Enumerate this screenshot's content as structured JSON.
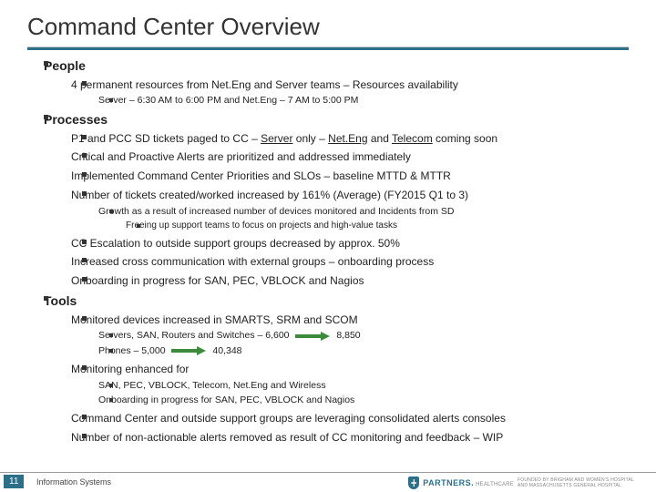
{
  "title": "Command Center Overview",
  "page_number": "11",
  "footer_label": "Information Systems",
  "logo": {
    "brand": "PARTNERS.",
    "sub": "HEALTHCARE",
    "tag": "FOUNDED BY BRIGHAM AND WOMEN'S HOSPITAL AND MASSACHUSETTS GENERAL HOSPITAL"
  },
  "sections": {
    "people": {
      "label": "People",
      "items": {
        "i0": "4 permanent resources from Net.Eng and Server teams – Resources availability",
        "i0_sub": "Server – 6:30 AM to 6:00 PM and Net.Eng – 7 AM to 5:00 PM"
      }
    },
    "processes": {
      "label": "Processes",
      "items": {
        "i0_pre": "P1 and PCC SD tickets paged to CC – ",
        "i0_u1": "Server",
        "i0_mid": " only – ",
        "i0_u2": "Net.Eng",
        "i0_and": " and ",
        "i0_u3": "Telecom",
        "i0_post": " coming soon",
        "i1": "Critical and Proactive Alerts are prioritized and addressed immediately",
        "i2": "Implemented Command Center Priorities and SLOs – baseline MTTD & MTTR",
        "i3": "Number of tickets created/worked increased by 161% (Average) (FY2015 Q1 to 3)",
        "i3_sub": "Growth as a result of increased number of devices monitored and Incidents from SD",
        "i3_sub_sub": "Freeing up support teams to focus on projects and high-value tasks",
        "i4": "CC Escalation to outside support groups decreased by approx. 50%",
        "i5": "Increased cross communication with external groups – onboarding process",
        "i6": "Onboarding in progress for SAN, PEC, VBLOCK and Nagios"
      }
    },
    "tools": {
      "label": "Tools",
      "items": {
        "i0": "Monitored devices increased in SMARTS, SRM and SCOM",
        "i0_sub1_a": "Servers, SAN, Routers and Switches – 6,600",
        "i0_sub1_b": "8,850",
        "i0_sub2_a": "Phones – 5,000",
        "i0_sub2_b": "40,348",
        "i1": "Monitoring enhanced for",
        "i1_sub1": "SAN, PEC, VBLOCK, Telecom, Net.Eng and Wireless",
        "i1_sub2": "Onboarding in progress for SAN, PEC, VBLOCK and Nagios",
        "i2": "Command Center and outside support groups are leveraging consolidated alerts consoles",
        "i3": "Number of non-actionable alerts removed as result of CC monitoring and feedback – WIP"
      }
    }
  }
}
